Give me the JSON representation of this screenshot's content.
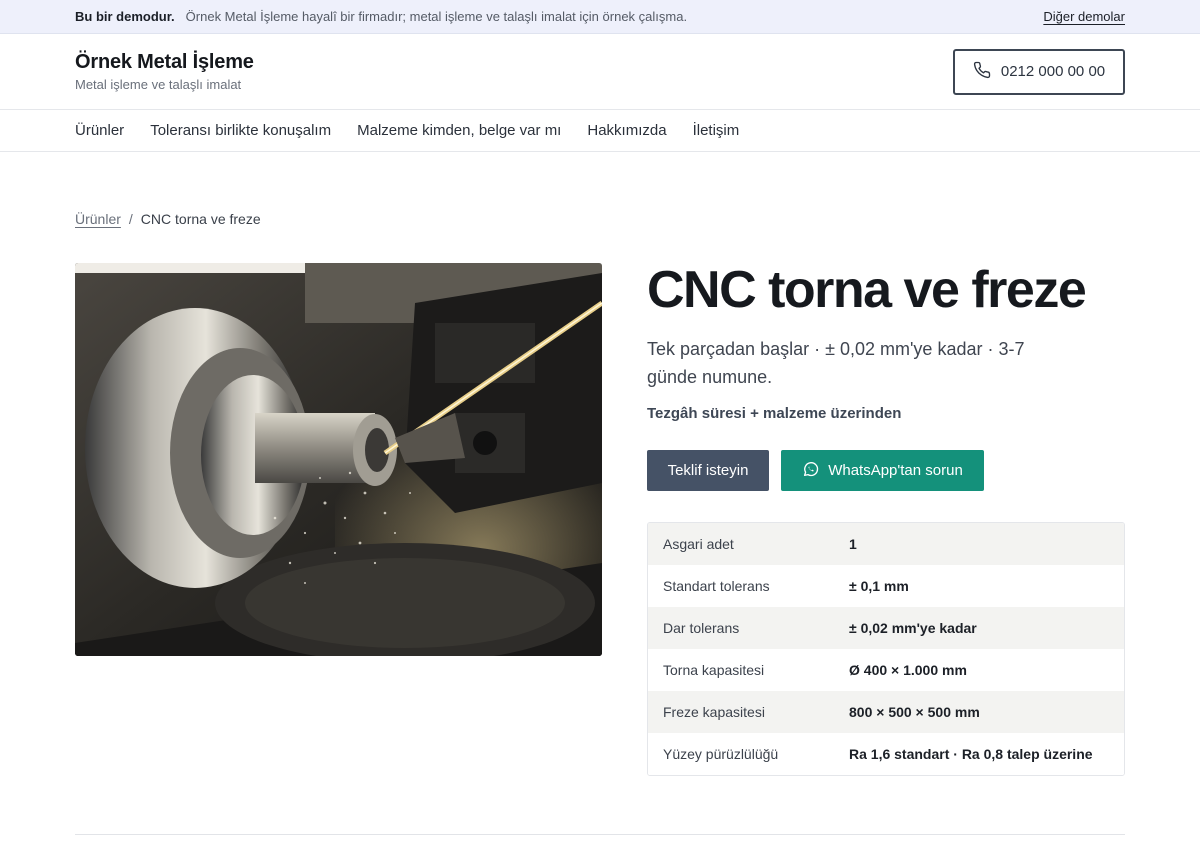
{
  "demo_bar": {
    "label": "Bu bir demodur.",
    "message": "Örnek Metal İşleme hayalî bir firmadır; metal işleme ve talaşlı imalat için örnek çalışma.",
    "other_demos": "Diğer demolar"
  },
  "header": {
    "brand_name": "Örnek Metal İşleme",
    "brand_tagline": "Metal işleme ve talaşlı imalat",
    "phone": "0212 000 00 00"
  },
  "nav": {
    "items": [
      "Ürünler",
      "Toleransı birlikte konuşalım",
      "Malzeme kimden, belge var mı",
      "Hakkımızda",
      "İletişim"
    ]
  },
  "breadcrumb": {
    "parent": "Ürünler",
    "separator": "/",
    "current": "CNC torna ve freze"
  },
  "product": {
    "title": "CNC torna ve freze",
    "lead": "Tek parçadan başlar · ± 0,02 mm'ye kadar · 3-7 günde numune.",
    "pricing": "Tezgâh süresi + malzeme üzerinden",
    "quote_button": "Teklif isteyin",
    "whatsapp_button": "WhatsApp'tan sorun",
    "specs": [
      {
        "label": "Asgari adet",
        "value": "1"
      },
      {
        "label": "Standart tolerans",
        "value": "± 0,1 mm"
      },
      {
        "label": "Dar tolerans",
        "value": "± 0,02 mm'ye kadar"
      },
      {
        "label": "Torna kapasitesi",
        "value": "Ø 400 × 1.000 mm"
      },
      {
        "label": "Freze kapasitesi",
        "value": "800 × 500 × 500 mm"
      },
      {
        "label": "Yüzey pürüzlülüğü",
        "value": "Ra 1,6 standart · Ra 0,8 talep üzerine"
      }
    ]
  },
  "colors": {
    "primary_button": "#455266",
    "whatsapp_button": "#14917b",
    "demo_bar_bg": "#eef0fb"
  },
  "icons": {
    "phone": "phone-icon",
    "whatsapp": "whatsapp-icon"
  }
}
